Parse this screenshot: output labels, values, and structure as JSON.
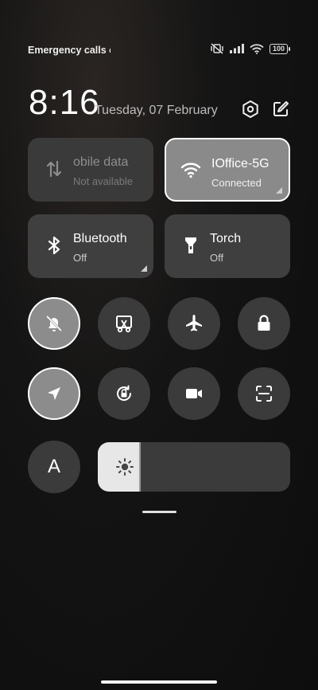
{
  "status": {
    "carrier_text": "Emergency calls o",
    "battery": "100",
    "icons": [
      "vibrate-off-icon",
      "signal-icon",
      "wifi-icon",
      "battery-icon"
    ]
  },
  "header": {
    "time": "8:16",
    "date": "Tuesday, 07 February",
    "icons": [
      "settings-icon",
      "edit-icon"
    ]
  },
  "tiles": [
    {
      "label": "obile data",
      "sub": "Not available",
      "icon": "data-arrows-icon",
      "state": "disabled"
    },
    {
      "label": "IOffice-5G",
      "sub": "Connected",
      "icon": "wifi-icon",
      "state": "active"
    },
    {
      "label": "Bluetooth",
      "sub": "Off",
      "icon": "bluetooth-icon",
      "state": "off"
    },
    {
      "label": "Torch",
      "sub": "Off",
      "icon": "torch-icon",
      "state": "off"
    }
  ],
  "toggles": [
    {
      "icon": "mute-bell-icon",
      "active": true
    },
    {
      "icon": "screenshot-icon",
      "active": false
    },
    {
      "icon": "airplane-icon",
      "active": false
    },
    {
      "icon": "lock-icon",
      "active": false
    },
    {
      "icon": "location-icon",
      "active": true
    },
    {
      "icon": "rotation-lock-icon",
      "active": false
    },
    {
      "icon": "video-camera-icon",
      "active": false
    },
    {
      "icon": "scanner-icon",
      "active": false
    }
  ],
  "font_button": {
    "label": "A"
  },
  "brightness": {
    "level": 0.22,
    "icon": "brightness-sun-icon"
  }
}
